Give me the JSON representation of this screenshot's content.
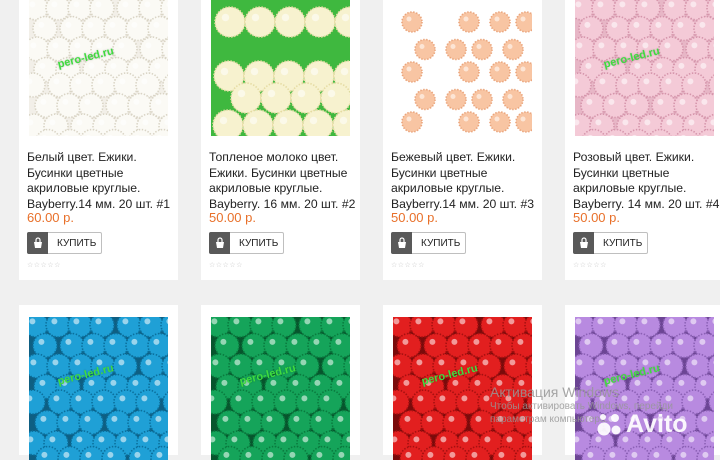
{
  "products": [
    {
      "title": "Белый цвет. Ежики. Бусинки цветные акриловые круглые. Bayberry.14 мм. 20 шт. #1",
      "price": "60.00 р.",
      "buy_label": "КУПИТЬ",
      "watermark": "pero-led.ru",
      "colors": {
        "bg": "#f2efe8",
        "bead": "#fbfaf5",
        "dot": "#d9d4c5"
      }
    },
    {
      "title": "Топленое молоко цвет. Ежики. Бусинки цветные акриловые круглые. Bayberry. 16 мм. 20 шт. #2",
      "price": "50.00 р.",
      "buy_label": "КУПИТЬ",
      "watermark": "",
      "colors": {
        "bg": "#3fb83f",
        "bead": "#f7f2cf",
        "dot": "#e5dba2"
      }
    },
    {
      "title": "Бежевый цвет. Ежики. Бусинки цветные акриловые круглые. Bayberry.14 мм. 20 шт. #3",
      "price": "50.00 р.",
      "buy_label": "КУПИТЬ",
      "watermark": "",
      "colors": {
        "bg": "#ffffff",
        "bead": "#f8c5a3",
        "dot": "#eaa57c"
      }
    },
    {
      "title": "Розовый цвет. Ежики. Бусинки цветные акриловые круглые. Bayberry. 14 мм. 20 шт. #4",
      "price": "50.00 р.",
      "buy_label": "КУПИТЬ",
      "watermark": "pero-led.ru",
      "colors": {
        "bg": "#e7b6c6",
        "bead": "#f4cad7",
        "dot": "#d595ab"
      }
    },
    {
      "watermark": "pero-led.ru",
      "colors": {
        "bg": "#0e5f83",
        "bead": "#1fa0d6",
        "dot": "#0b6f9c"
      }
    },
    {
      "watermark": "pero-led.ru",
      "colors": {
        "bg": "#07552d",
        "bead": "#15a45a",
        "dot": "#0a7a3e"
      }
    },
    {
      "watermark": "pero-led.ru",
      "colors": {
        "bg": "#7a0b0b",
        "bead": "#e21f1f",
        "dot": "#a51010"
      }
    },
    {
      "watermark": "pero-led.ru",
      "colors": {
        "bg": "#6c4594",
        "bead": "#b88ae0",
        "dot": "#8b60b5"
      }
    }
  ],
  "rating_stars": "☆☆☆☆☆",
  "overlay": {
    "activation_title": "Активация Windows",
    "activation_line1": "Чтобы активировать Windows, перейди",
    "activation_line2": "параметрам компьютера.",
    "avito_label": "Avito"
  },
  "icons": {
    "buy": "basket-icon",
    "rating": "star-icon",
    "avito": "avito-logo-icon"
  }
}
